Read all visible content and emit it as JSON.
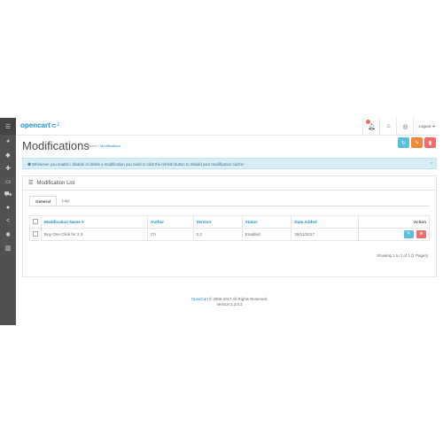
{
  "header": {
    "logo_text": "opencart",
    "logo_cart": "⊂┘",
    "logout_label": "Logout",
    "alert_count": ""
  },
  "sidebar": {
    "items": [
      {
        "icon": "dashboard-icon",
        "glyph": "◕"
      },
      {
        "icon": "tags-icon",
        "glyph": "◆"
      },
      {
        "icon": "puzzle-icon",
        "glyph": "✚"
      },
      {
        "icon": "desktop-icon",
        "glyph": "▭"
      },
      {
        "icon": "cart-icon",
        "glyph": "⛟"
      },
      {
        "icon": "user-icon",
        "glyph": "●"
      },
      {
        "icon": "share-icon",
        "glyph": "<"
      },
      {
        "icon": "cog-icon",
        "glyph": "✺"
      },
      {
        "icon": "chart-icon",
        "glyph": "▥"
      }
    ]
  },
  "page": {
    "title": "Modifications",
    "breadcrumb": {
      "home": "Home",
      "separator": "/",
      "current": "Modifications"
    }
  },
  "alert": {
    "text": "Whenever you enable / disable or delete a modification you need to click the refresh button to rebuild your modification cache!",
    "close": "×"
  },
  "panel": {
    "title": "Modification List",
    "tabs": [
      {
        "label": "General"
      },
      {
        "label": "Log"
      }
    ]
  },
  "table": {
    "headers": {
      "name": "Modification Name ▾",
      "author": "Author",
      "version": "Version",
      "status": "Status",
      "date": "Date Added",
      "action": "Action"
    },
    "rows": [
      {
        "name": "Buy One Click for 2.3",
        "author": "Ch",
        "version": "2.2",
        "status": "Enabled",
        "date": "29/11/2017"
      }
    ]
  },
  "pagination": {
    "text": "Showing 1 to 1 of 1 (1 Pages)"
  },
  "footer": {
    "link": "OpenCart",
    "copyright": "© 2009-2017 All Rights Reserved.",
    "version": "Version 2.3.0.2"
  },
  "colors": {
    "primary": "#1e91cf",
    "info": "#5bc0de",
    "warning": "#f38733",
    "danger": "#f56b6b",
    "sidebar": "#515151"
  }
}
